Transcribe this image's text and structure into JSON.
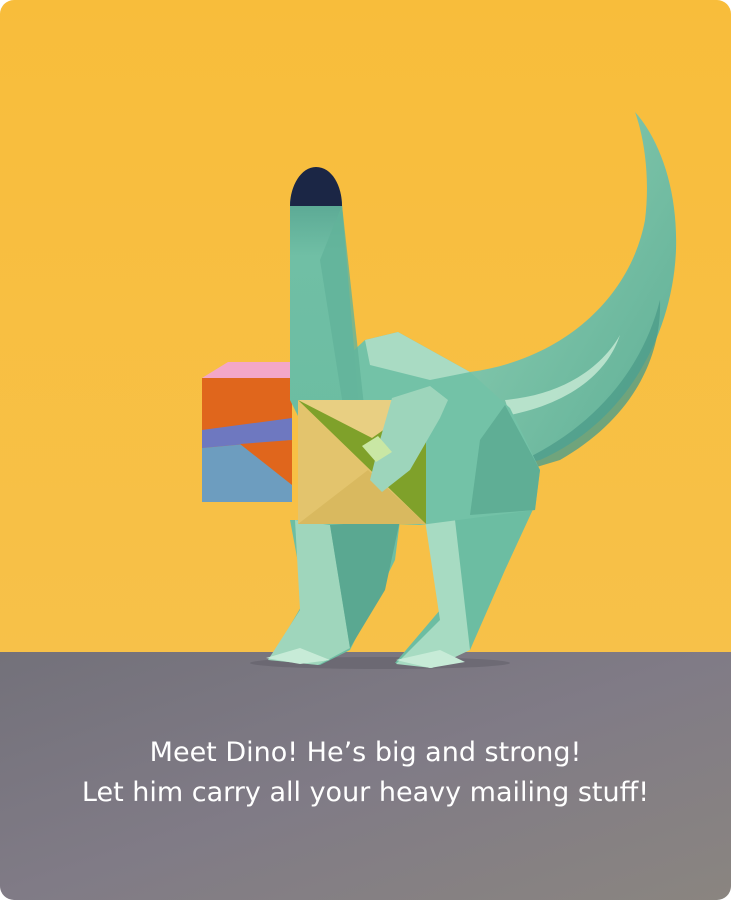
{
  "card": {
    "caption_line_1": "Meet Dino! He’s big and strong!",
    "caption_line_2": "Let him carry all your heavy mailing stuff!"
  },
  "colors": {
    "wall": "#F7BE3E",
    "floor": "#7E7983",
    "dino_body": "#6DBFA3",
    "dino_light": "#A8DCC3",
    "dino_dark": "#4E9C89",
    "cap": "#1B2645",
    "envelope": "#E3C46D",
    "envelope_flap": "#7FA12A",
    "parcel_orange": "#E0661C",
    "parcel_pink": "#F2A9C9",
    "parcel_stripe": "#6C7AC2",
    "parcel_blue": "#6C9CBF",
    "caption_text": "#FFFFFF"
  },
  "icons": {
    "illustration": "dino-mail-carrier-illustration"
  }
}
